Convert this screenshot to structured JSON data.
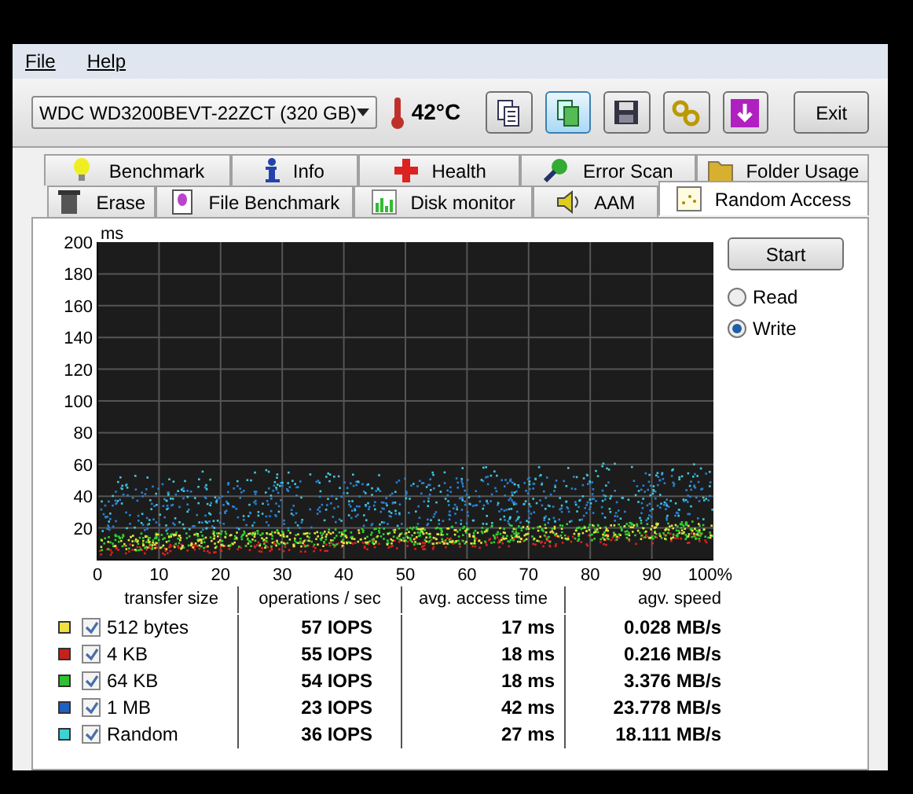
{
  "menu": [
    "File",
    "Help"
  ],
  "drive_select": {
    "value": "WDC WD3200BEVT-22ZCT (320 GB)"
  },
  "temperature": "42°C",
  "toolbar": [
    {
      "kind": "copy",
      "selected": false
    },
    {
      "kind": "copy-green",
      "selected": true
    },
    {
      "kind": "save",
      "selected": false
    },
    {
      "kind": "chain",
      "selected": false
    },
    {
      "kind": "download",
      "selected": false
    }
  ],
  "exit_button": "Exit",
  "tabs_row_1": [
    {
      "label": "Benchmark",
      "kind": "bulb",
      "selected": false
    },
    {
      "label": "Info",
      "kind": "info",
      "selected": false
    },
    {
      "label": "Health",
      "kind": "cross",
      "selected": false
    },
    {
      "label": "Error Scan",
      "kind": "magnifier",
      "selected": false
    },
    {
      "label": "Folder Usage",
      "kind": "folder",
      "selected": false
    }
  ],
  "tabs_row_2": [
    {
      "label": "Erase",
      "kind": "bin",
      "selected": false
    },
    {
      "label": "File Benchmark",
      "kind": "file",
      "selected": false
    },
    {
      "label": "Disk monitor",
      "kind": "bars",
      "selected": false
    },
    {
      "label": "AAM",
      "kind": "speaker",
      "selected": false
    },
    {
      "label": "Random Access",
      "kind": "dots",
      "selected": true
    }
  ],
  "plot": {
    "ylabel": "ms",
    "y_ticks": [
      "200",
      "180",
      "160",
      "140",
      "120",
      "100",
      "80",
      "60",
      "40",
      "20"
    ],
    "x_ticks": [
      "0",
      "10",
      "20",
      "30",
      "40",
      "50",
      "60",
      "70",
      "80",
      "90",
      "100%"
    ]
  },
  "start_button": "Start",
  "mode": [
    {
      "label": "Read",
      "selected": false
    },
    {
      "label": "Write",
      "selected": true
    }
  ],
  "table": {
    "columns": [
      "transfer size",
      "operations / sec",
      "avg. access time",
      "agv. speed"
    ],
    "rows": [
      {
        "color": "#f0e040",
        "checked": true,
        "size": "512 bytes",
        "ops": "57 IOPS",
        "time": "17 ms",
        "speed": "0.028 MB/s"
      },
      {
        "color": "#c8201c",
        "checked": true,
        "size": "4 KB",
        "ops": "55 IOPS",
        "time": "18 ms",
        "speed": "0.216 MB/s"
      },
      {
        "color": "#30c030",
        "checked": true,
        "size": "64 KB",
        "ops": "54 IOPS",
        "time": "18 ms",
        "speed": "3.376 MB/s"
      },
      {
        "color": "#2060c0",
        "checked": true,
        "size": "1 MB",
        "ops": "23 IOPS",
        "time": "42 ms",
        "speed": "23.778 MB/s"
      },
      {
        "color": "#40d0d8",
        "checked": true,
        "size": "Random",
        "ops": "36 IOPS",
        "time": "27 ms",
        "speed": "18.111 MB/s"
      }
    ]
  }
}
